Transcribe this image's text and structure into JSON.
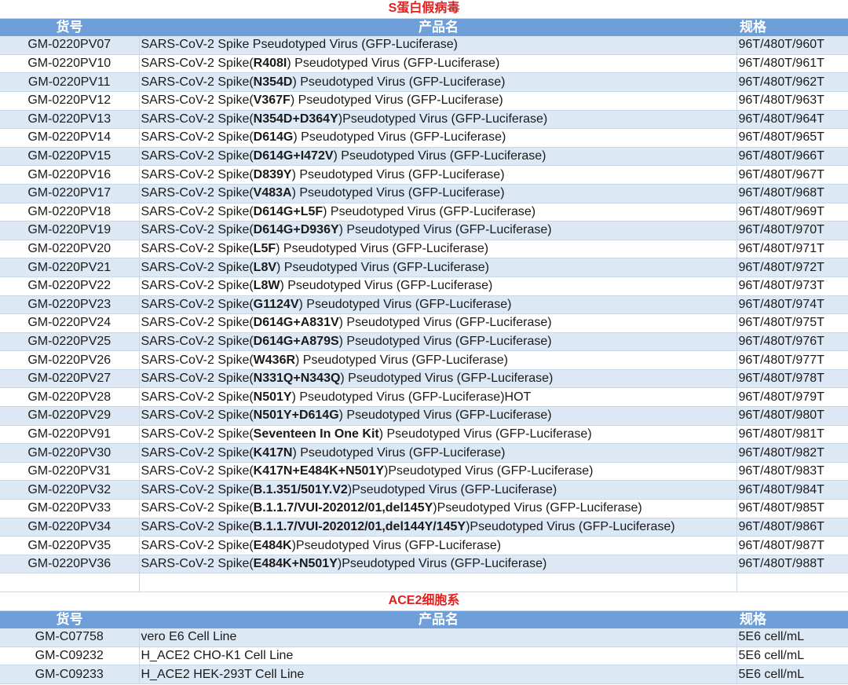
{
  "sections": [
    {
      "title": "S蛋白假病毒",
      "headers": {
        "code": "货号",
        "name": "产品名",
        "spec": "规格"
      },
      "rows": [
        {
          "code": "GM-0220PV07",
          "pre": "SARS-CoV-2 Spike Pseudotyped Virus (GFP-Luciferase)",
          "bold": "",
          "post": "",
          "spec": "96T/480T/960T"
        },
        {
          "code": "GM-0220PV10",
          "pre": "SARS-CoV-2 Spike(",
          "bold": "R408I",
          "post": ") Pseudotyped Virus (GFP-Luciferase)",
          "spec": "96T/480T/961T"
        },
        {
          "code": "GM-0220PV11",
          "pre": "SARS-CoV-2 Spike(",
          "bold": "N354D",
          "post": ") Pseudotyped Virus (GFP-Luciferase)",
          "spec": "96T/480T/962T"
        },
        {
          "code": "GM-0220PV12",
          "pre": "SARS-CoV-2 Spike(",
          "bold": "V367F",
          "post": ") Pseudotyped Virus (GFP-Luciferase)",
          "spec": "96T/480T/963T"
        },
        {
          "code": "GM-0220PV13",
          "pre": "SARS-CoV-2 Spike(",
          "bold": "N354D+D364Y",
          "post": ")Pseudotyped Virus (GFP-Luciferase)",
          "spec": "96T/480T/964T"
        },
        {
          "code": "GM-0220PV14",
          "pre": "SARS-CoV-2 Spike(",
          "bold": "D614G",
          "post": ") Pseudotyped Virus (GFP-Luciferase)",
          "spec": "96T/480T/965T"
        },
        {
          "code": "GM-0220PV15",
          "pre": "SARS-CoV-2 Spike(",
          "bold": "D614G+I472V",
          "post": ") Pseudotyped Virus (GFP-Luciferase)",
          "spec": "96T/480T/966T"
        },
        {
          "code": "GM-0220PV16",
          "pre": "SARS-CoV-2 Spike(",
          "bold": "D839Y",
          "post": ") Pseudotyped Virus (GFP-Luciferase)",
          "spec": "96T/480T/967T"
        },
        {
          "code": "GM-0220PV17",
          "pre": "SARS-CoV-2 Spike(",
          "bold": "V483A",
          "post": ") Pseudotyped Virus (GFP-Luciferase)",
          "spec": "96T/480T/968T"
        },
        {
          "code": "GM-0220PV18",
          "pre": "SARS-CoV-2 Spike(",
          "bold": "D614G+L5F",
          "post": ") Pseudotyped Virus (GFP-Luciferase)",
          "spec": "96T/480T/969T"
        },
        {
          "code": "GM-0220PV19",
          "pre": "SARS-CoV-2 Spike(",
          "bold": "D614G+D936Y",
          "post": ") Pseudotyped Virus (GFP-Luciferase)",
          "spec": "96T/480T/970T"
        },
        {
          "code": "GM-0220PV20",
          "pre": "SARS-CoV-2 Spike(",
          "bold": "L5F",
          "post": ") Pseudotyped Virus (GFP-Luciferase)",
          "spec": "96T/480T/971T"
        },
        {
          "code": "GM-0220PV21",
          "pre": "SARS-CoV-2 Spike(",
          "bold": "L8V",
          "post": ") Pseudotyped Virus (GFP-Luciferase)",
          "spec": "96T/480T/972T"
        },
        {
          "code": "GM-0220PV22",
          "pre": "SARS-CoV-2 Spike(",
          "bold": "L8W",
          "post": ") Pseudotyped Virus (GFP-Luciferase)",
          "spec": "96T/480T/973T"
        },
        {
          "code": "GM-0220PV23",
          "pre": "SARS-CoV-2 Spike(",
          "bold": "G1124V",
          "post": ") Pseudotyped Virus (GFP-Luciferase)",
          "spec": "96T/480T/974T"
        },
        {
          "code": "GM-0220PV24",
          "pre": "SARS-CoV-2 Spike(",
          "bold": "D614G+A831V",
          "post": ") Pseudotyped Virus (GFP-Luciferase)",
          "spec": "96T/480T/975T"
        },
        {
          "code": "GM-0220PV25",
          "pre": "SARS-CoV-2 Spike(",
          "bold": "D614G+A879S",
          "post": ") Pseudotyped Virus (GFP-Luciferase)",
          "spec": "96T/480T/976T"
        },
        {
          "code": "GM-0220PV26",
          "pre": "SARS-CoV-2 Spike(",
          "bold": "W436R",
          "post": ") Pseudotyped Virus (GFP-Luciferase)",
          "spec": "96T/480T/977T"
        },
        {
          "code": "GM-0220PV27",
          "pre": "SARS-CoV-2 Spike(",
          "bold": "N331Q+N343Q",
          "post": ") Pseudotyped Virus (GFP-Luciferase)",
          "spec": "96T/480T/978T"
        },
        {
          "code": "GM-0220PV28",
          "pre": "SARS-CoV-2 Spike(",
          "bold": "N501Y",
          "post": ") Pseudotyped Virus (GFP-Luciferase)HOT",
          "spec": "96T/480T/979T"
        },
        {
          "code": "GM-0220PV29",
          "pre": "SARS-CoV-2 Spike(",
          "bold": "N501Y+D614G",
          "post": ") Pseudotyped Virus (GFP-Luciferase)",
          "spec": "96T/480T/980T"
        },
        {
          "code": "GM-0220PV91",
          "pre": "SARS-CoV-2 Spike(",
          "bold": "Seventeen In One Kit",
          "post": ") Pseudotyped Virus (GFP-Luciferase)",
          "spec": "96T/480T/981T"
        },
        {
          "code": "GM-0220PV30",
          "pre": "SARS-CoV-2 Spike(",
          "bold": "K417N",
          "post": ") Pseudotyped Virus (GFP-Luciferase)",
          "spec": "96T/480T/982T"
        },
        {
          "code": "GM-0220PV31",
          "pre": "SARS-CoV-2 Spike(",
          "bold": "K417N+E484K+N501Y",
          "post": ")Pseudotyped Virus (GFP-Luciferase)",
          "spec": "96T/480T/983T"
        },
        {
          "code": "GM-0220PV32",
          "pre": "SARS-CoV-2 Spike(",
          "bold": "B.1.351/501Y.V2",
          "post": ")Pseudotyped Virus (GFP-Luciferase)",
          "spec": "96T/480T/984T"
        },
        {
          "code": "GM-0220PV33",
          "pre": "SARS-CoV-2 Spike(",
          "bold": "B.1.1.7/VUI-202012/01,del145Y",
          "post": ")Pseudotyped Virus (GFP-Luciferase)",
          "spec": "96T/480T/985T"
        },
        {
          "code": "GM-0220PV34",
          "pre": "SARS-CoV-2 Spike(",
          "bold": "B.1.1.7/VUI-202012/01,del144Y/145Y",
          "post": ")Pseudotyped Virus (GFP-Luciferase)",
          "spec": "96T/480T/986T"
        },
        {
          "code": "GM-0220PV35",
          "pre": "SARS-CoV-2 Spike(",
          "bold": "E484K",
          "post": ")Pseudotyped Virus (GFP-Luciferase)",
          "spec": "96T/480T/987T"
        },
        {
          "code": "GM-0220PV36",
          "pre": "SARS-CoV-2 Spike(",
          "bold": "E484K+N501Y",
          "post": ")Pseudotyped Virus (GFP-Luciferase)",
          "spec": "96T/480T/988T"
        }
      ]
    },
    {
      "title": "ACE2细胞系",
      "headers": {
        "code": "货号",
        "name": "产品名",
        "spec": "规格"
      },
      "rows": [
        {
          "code": "GM-C07758",
          "pre": "vero E6 Cell Line",
          "bold": "",
          "post": "",
          "spec": "5E6 cell/mL"
        },
        {
          "code": "GM-C09232",
          "pre": "H_ACE2 CHO-K1 Cell Line",
          "bold": "",
          "post": "",
          "spec": "5E6 cell/mL"
        },
        {
          "code": "GM-C09233",
          "pre": "H_ACE2 HEK-293T Cell Line",
          "bold": "",
          "post": "",
          "spec": "5E6 cell/mL"
        }
      ]
    }
  ],
  "colors": {
    "title": "#e0201f",
    "header_bg": "#6f9fd8",
    "row_alt_bg": "#dde8f5"
  }
}
